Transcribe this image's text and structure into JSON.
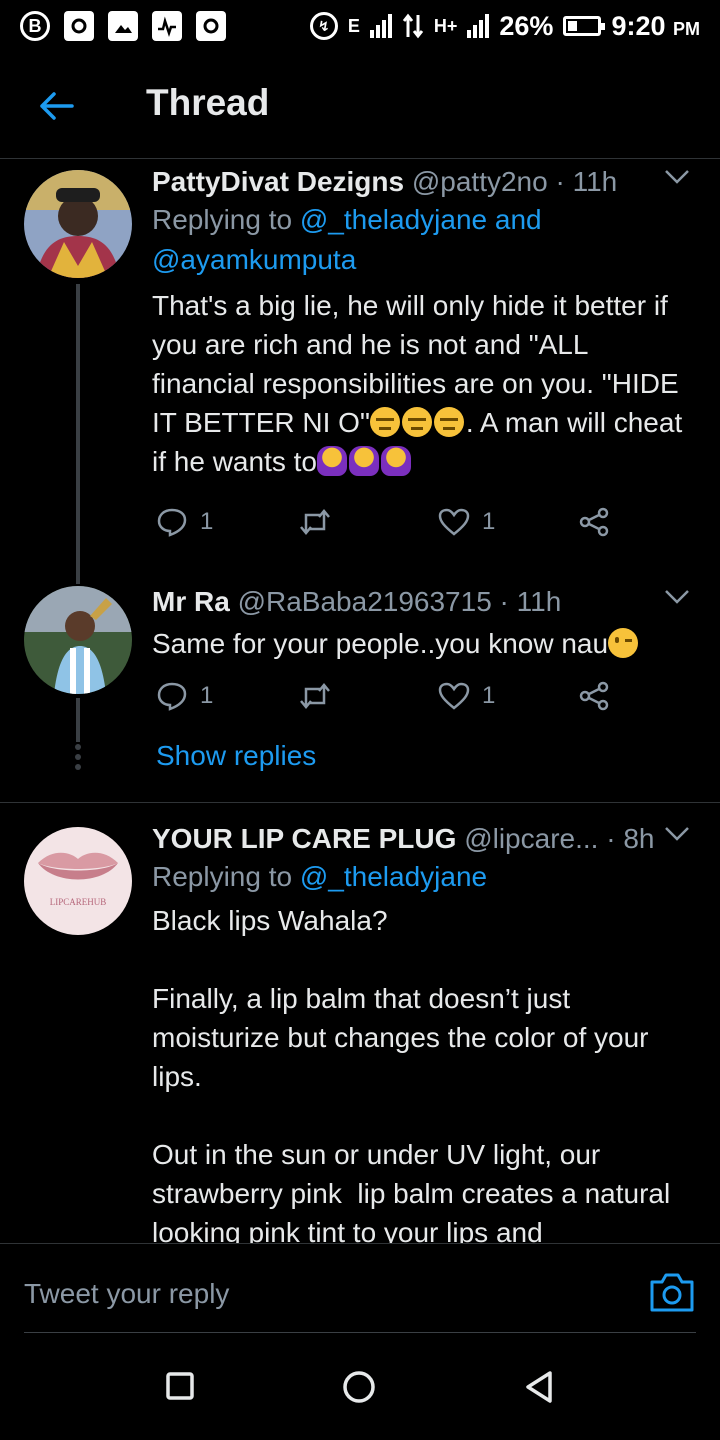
{
  "status_bar": {
    "time": "9:20",
    "ampm": "PM",
    "battery": "26%",
    "battery_level": 0.26,
    "network_a": "E",
    "network_b": "H+",
    "left_icons": [
      "b-circle-icon",
      "photo-box-icon",
      "image-icon",
      "activity-icon",
      "photo-box-icon"
    ]
  },
  "header": {
    "title": "Thread"
  },
  "tweets": [
    {
      "name": "PattyDivat Dezigns",
      "handle": "@patty2no",
      "time": "· 11h",
      "replying_prefix": "Replying to ",
      "replying_mentions": "@_theladyjane and @ayamkumputa",
      "text_1": "That's a big lie, he will only hide it better if you are rich and he is not and \"ALL financial responsibilities are on you. \"HIDE IT BETTER NI O\"",
      "text_2": ". A man will cheat if he wants to",
      "reply_count": "1",
      "like_count": "1"
    },
    {
      "name": "Mr Ra",
      "handle": "@RaBaba21963715",
      "time": "· 11h",
      "text_1": "Same for your people..you know nau",
      "reply_count": "1",
      "like_count": "1"
    },
    {
      "name": "YOUR LIP CARE PLUG",
      "handle": "@lipcare...",
      "time": "· 8h",
      "replying_prefix": "Replying to ",
      "replying_mentions": "@_theladyjane",
      "avatar_text": "LIPCAREHUB",
      "text_1": "Black lips Wahala?\n\nFinally, a lip balm that doesn’t just moisturize but changes the color of your lips.\n\nOut in the sun or under UV light, our strawberry pink  lip balm creates a natural looking pink tint to your lips and"
    }
  ],
  "show_replies": "Show replies",
  "composer": {
    "placeholder": "Tweet your reply"
  },
  "colors": {
    "accent": "#1d9bf0",
    "muted": "#8b98a5",
    "background": "#000000"
  }
}
